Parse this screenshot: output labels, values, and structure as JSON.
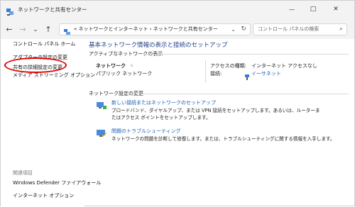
{
  "window": {
    "title": "ネットワークと共有センター",
    "controls": {
      "minimize_icon": "—",
      "maximize_icon": "□",
      "close_icon": "✕"
    }
  },
  "nav": {
    "back_icon": "←",
    "forward_icon": "→",
    "dropdown_icon": "⌄",
    "up_icon": "↑",
    "address_path": "«  ネットワークとインターネット  ›  ネットワークと共有センター",
    "address_dropdown_icon": "⌄",
    "refresh_icon": "↻",
    "search_placeholder": "コントロール パネルの検索",
    "search_icon": "⌕"
  },
  "sidebar": {
    "items": [
      {
        "label": "コントロール パネル ホーム"
      },
      {
        "label": "アダプターの設定の変更"
      },
      {
        "label": "共有の詳細設定の変更"
      },
      {
        "label": "メディア ストリーミング オプション"
      }
    ],
    "related_heading": "関連項目",
    "related": [
      {
        "label": "Windows Defender ファイアウォール"
      },
      {
        "label": "インターネット オプション"
      }
    ]
  },
  "main": {
    "heading": "基本ネットワーク情報の表示と接続のセットアップ",
    "active_networks_label": "アクティブなネットワークの表示",
    "network": {
      "name": "ネットワーク",
      "name_suffix": "s",
      "type": "パブリック ネットワーク",
      "access_type_label": "アクセスの種類:",
      "access_type_value": "インターネット アクセスなし",
      "connections_label": "接続:",
      "connection_value": "イーサネット"
    },
    "change_settings_label": "ネットワーク設定の変更",
    "tasks": [
      {
        "link": "新しい接続またはネットワークのセットアップ",
        "description": "ブロードバンド、ダイヤルアップ、または VPN 接続をセットアップします。あるいは、ルーターまたはアクセス ポイントをセットアップします。"
      },
      {
        "link": "問題のトラブルシューティング",
        "description": "ネットワークの問題を診断して修復します。または、トラブルシューティングに関する情報を入手します。"
      }
    ]
  },
  "colors": {
    "accent_link": "#1a5fb4",
    "heading": "#1e3b87",
    "highlight_oval": "#e00000"
  }
}
